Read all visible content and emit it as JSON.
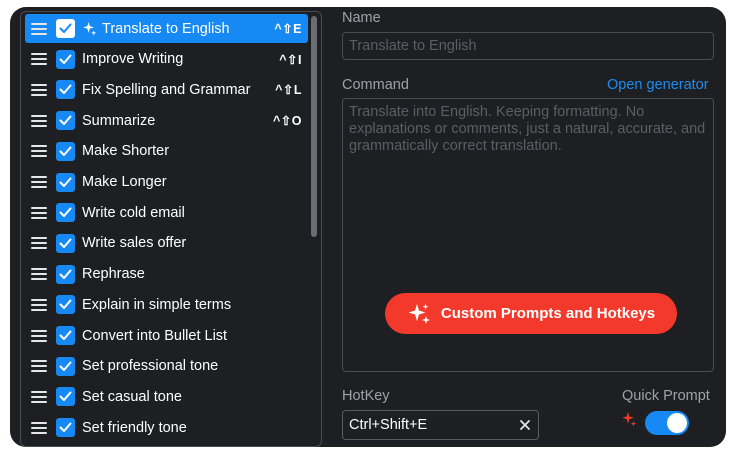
{
  "prompts": {
    "items": [
      {
        "label": "Translate to English",
        "hotkey": "^⇧E",
        "active": true,
        "checked": true
      },
      {
        "label": "Improve Writing",
        "hotkey": "^⇧I",
        "active": false,
        "checked": true
      },
      {
        "label": "Fix Spelling and Grammar",
        "hotkey": "^⇧L",
        "active": false,
        "checked": true
      },
      {
        "label": "Summarize",
        "hotkey": "^⇧O",
        "active": false,
        "checked": true
      },
      {
        "label": "Make Shorter",
        "hotkey": "",
        "active": false,
        "checked": true
      },
      {
        "label": "Make Longer",
        "hotkey": "",
        "active": false,
        "checked": true
      },
      {
        "label": "Write cold email",
        "hotkey": "",
        "active": false,
        "checked": true
      },
      {
        "label": "Write sales offer",
        "hotkey": "",
        "active": false,
        "checked": true
      },
      {
        "label": "Rephrase",
        "hotkey": "",
        "active": false,
        "checked": true
      },
      {
        "label": "Explain in simple terms",
        "hotkey": "",
        "active": false,
        "checked": true
      },
      {
        "label": "Convert into Bullet List",
        "hotkey": "",
        "active": false,
        "checked": true
      },
      {
        "label": "Set professional tone",
        "hotkey": "",
        "active": false,
        "checked": true
      },
      {
        "label": "Set casual tone",
        "hotkey": "",
        "active": false,
        "checked": true
      },
      {
        "label": "Set friendly tone",
        "hotkey": "",
        "active": false,
        "checked": true
      }
    ]
  },
  "form": {
    "name_label": "Name",
    "name_placeholder": "Translate to English",
    "command_label": "Command",
    "open_generator": "Open generator",
    "command_placeholder": "Translate into English. Keeping formatting. No explanations or comments, just a natural, accurate, and grammatically correct translation.",
    "promo_button": "Custom Prompts and Hotkeys",
    "hotkey_label": "HotKey",
    "hotkey_value": "Ctrl+Shift+E",
    "quick_prompt_label": "Quick Prompt",
    "quick_prompt_enabled": true
  },
  "colors": {
    "background": "#1e1f22",
    "accent": "#1789f5",
    "promo": "#f2392b",
    "link": "#1e8cf0"
  },
  "icons": {
    "drag": "drag-handle-icon",
    "check": "checkmark-icon",
    "sparkle": "sparkle-icon",
    "clear": "close-icon"
  }
}
